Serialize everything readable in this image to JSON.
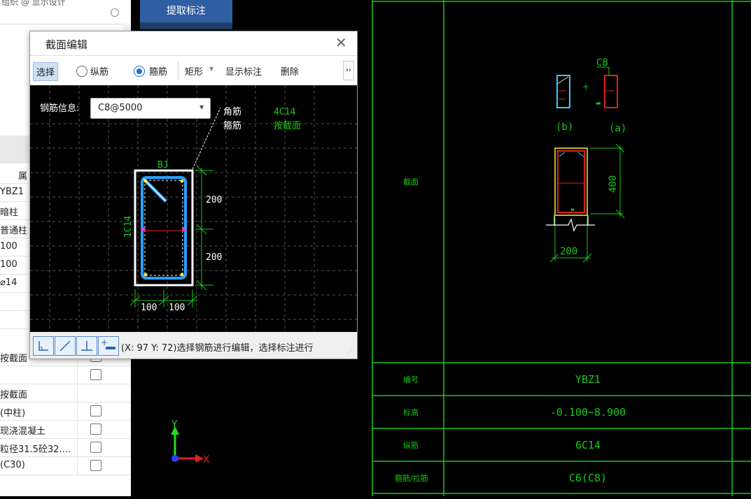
{
  "window": {
    "top_left_text": "组织  @ 显示设计"
  },
  "mid": {
    "extract_button": "提取标注"
  },
  "left_panel": {
    "header_attr": "属",
    "values": [
      "YBZ1",
      "暗柱",
      "普通柱",
      "100",
      "100",
      "⌀14"
    ],
    "checklist": [
      {
        "label": "按截面",
        "checked": false
      },
      {
        "label": "",
        "checked": false
      },
      {
        "label": "按截面",
        "checked": null
      },
      {
        "label": "(中柱)",
        "checked": false
      },
      {
        "label": "现浇混凝土",
        "checked": false
      },
      {
        "label": "粒径31.5砼32....",
        "checked": false
      },
      {
        "label": "(C30)",
        "checked": false
      }
    ]
  },
  "dialog": {
    "title": "截面编辑",
    "toolbar": {
      "select": "选择",
      "longitudinal": "纵筋",
      "stirrup": "箍筋",
      "shape": "矩形",
      "show_annotation": "显示标注",
      "delete": "删除",
      "more": "››"
    },
    "rebar_info_label": "钢筋信息:",
    "rebar_info_value": "C8@5000",
    "canvas": {
      "corner_bar_label": "角筋",
      "stirrup_label": "箍筋",
      "corner_bar_value": "4C14",
      "by_section": "按截面",
      "bj_label": "BJ",
      "side_label": "1C14",
      "dim_top": "200",
      "dim_bottom": "200",
      "dim_left": "100",
      "dim_right": "100"
    },
    "status_text": "(X: 97 Y: 72)选择钢筋进行编辑，选择标注进行"
  },
  "axes": {
    "x": "X",
    "y": "Y"
  },
  "drawing": {
    "bar_c8": "C8",
    "label_b": "(b)",
    "label_a": "(a)",
    "dim_400": "400",
    "dim_200": "200",
    "rows": [
      {
        "label": "截面",
        "value": ""
      },
      {
        "label": "编号",
        "value": "YBZ1"
      },
      {
        "label": "标高",
        "value": "-0.100~8.900"
      },
      {
        "label": "纵筋",
        "value": "6C14"
      },
      {
        "label": "箍筋/拉筋",
        "value": "C6(C8)"
      }
    ]
  }
}
